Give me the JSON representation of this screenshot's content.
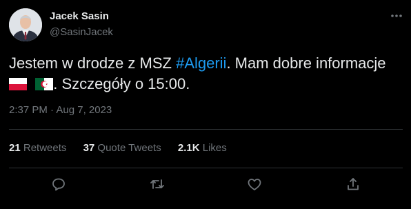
{
  "author": {
    "name": "Jacek Sasin",
    "handle": "@SasinJacek"
  },
  "tweet": {
    "text_before": "Jestem w drodze z MSZ ",
    "hashtag": "#Algerii",
    "text_after": ". Mam dobre informacje",
    "text_end": ". Szczegóły o 15:00.",
    "flags": [
      "poland-flag",
      "algeria-flag"
    ]
  },
  "meta": {
    "timestamp": "2:37 PM · Aug 7, 2023"
  },
  "stats": {
    "retweets_count": "21",
    "retweets_label": "Retweets",
    "quotes_count": "37",
    "quotes_label": "Quote Tweets",
    "likes_count": "2.1K",
    "likes_label": "Likes"
  },
  "actions": [
    "reply-icon",
    "retweet-icon",
    "like-icon",
    "share-icon"
  ],
  "colors": {
    "background": "#000000",
    "text": "#e7e9ea",
    "secondary": "#71767b",
    "link": "#1d9bf0",
    "divider": "#2f3336"
  }
}
